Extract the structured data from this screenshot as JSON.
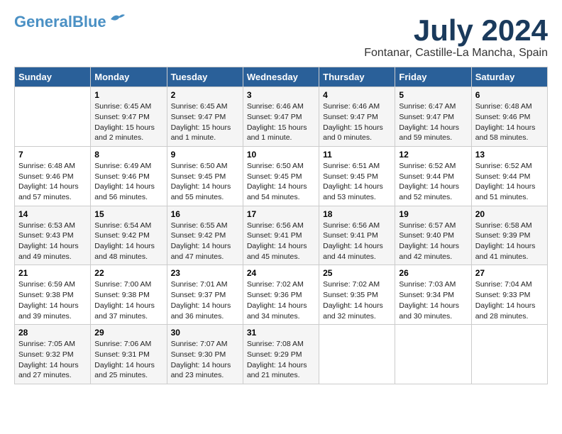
{
  "header": {
    "logo_line1": "General",
    "logo_line2": "Blue",
    "month_title": "July 2024",
    "location": "Fontanar, Castille-La Mancha, Spain"
  },
  "days_of_week": [
    "Sunday",
    "Monday",
    "Tuesday",
    "Wednesday",
    "Thursday",
    "Friday",
    "Saturday"
  ],
  "weeks": [
    [
      {
        "day": "",
        "info": ""
      },
      {
        "day": "1",
        "info": "Sunrise: 6:45 AM\nSunset: 9:47 PM\nDaylight: 15 hours\nand 2 minutes."
      },
      {
        "day": "2",
        "info": "Sunrise: 6:45 AM\nSunset: 9:47 PM\nDaylight: 15 hours\nand 1 minute."
      },
      {
        "day": "3",
        "info": "Sunrise: 6:46 AM\nSunset: 9:47 PM\nDaylight: 15 hours\nand 1 minute."
      },
      {
        "day": "4",
        "info": "Sunrise: 6:46 AM\nSunset: 9:47 PM\nDaylight: 15 hours\nand 0 minutes."
      },
      {
        "day": "5",
        "info": "Sunrise: 6:47 AM\nSunset: 9:47 PM\nDaylight: 14 hours\nand 59 minutes."
      },
      {
        "day": "6",
        "info": "Sunrise: 6:48 AM\nSunset: 9:46 PM\nDaylight: 14 hours\nand 58 minutes."
      }
    ],
    [
      {
        "day": "7",
        "info": "Sunrise: 6:48 AM\nSunset: 9:46 PM\nDaylight: 14 hours\nand 57 minutes."
      },
      {
        "day": "8",
        "info": "Sunrise: 6:49 AM\nSunset: 9:46 PM\nDaylight: 14 hours\nand 56 minutes."
      },
      {
        "day": "9",
        "info": "Sunrise: 6:50 AM\nSunset: 9:45 PM\nDaylight: 14 hours\nand 55 minutes."
      },
      {
        "day": "10",
        "info": "Sunrise: 6:50 AM\nSunset: 9:45 PM\nDaylight: 14 hours\nand 54 minutes."
      },
      {
        "day": "11",
        "info": "Sunrise: 6:51 AM\nSunset: 9:45 PM\nDaylight: 14 hours\nand 53 minutes."
      },
      {
        "day": "12",
        "info": "Sunrise: 6:52 AM\nSunset: 9:44 PM\nDaylight: 14 hours\nand 52 minutes."
      },
      {
        "day": "13",
        "info": "Sunrise: 6:52 AM\nSunset: 9:44 PM\nDaylight: 14 hours\nand 51 minutes."
      }
    ],
    [
      {
        "day": "14",
        "info": "Sunrise: 6:53 AM\nSunset: 9:43 PM\nDaylight: 14 hours\nand 49 minutes."
      },
      {
        "day": "15",
        "info": "Sunrise: 6:54 AM\nSunset: 9:42 PM\nDaylight: 14 hours\nand 48 minutes."
      },
      {
        "day": "16",
        "info": "Sunrise: 6:55 AM\nSunset: 9:42 PM\nDaylight: 14 hours\nand 47 minutes."
      },
      {
        "day": "17",
        "info": "Sunrise: 6:56 AM\nSunset: 9:41 PM\nDaylight: 14 hours\nand 45 minutes."
      },
      {
        "day": "18",
        "info": "Sunrise: 6:56 AM\nSunset: 9:41 PM\nDaylight: 14 hours\nand 44 minutes."
      },
      {
        "day": "19",
        "info": "Sunrise: 6:57 AM\nSunset: 9:40 PM\nDaylight: 14 hours\nand 42 minutes."
      },
      {
        "day": "20",
        "info": "Sunrise: 6:58 AM\nSunset: 9:39 PM\nDaylight: 14 hours\nand 41 minutes."
      }
    ],
    [
      {
        "day": "21",
        "info": "Sunrise: 6:59 AM\nSunset: 9:38 PM\nDaylight: 14 hours\nand 39 minutes."
      },
      {
        "day": "22",
        "info": "Sunrise: 7:00 AM\nSunset: 9:38 PM\nDaylight: 14 hours\nand 37 minutes."
      },
      {
        "day": "23",
        "info": "Sunrise: 7:01 AM\nSunset: 9:37 PM\nDaylight: 14 hours\nand 36 minutes."
      },
      {
        "day": "24",
        "info": "Sunrise: 7:02 AM\nSunset: 9:36 PM\nDaylight: 14 hours\nand 34 minutes."
      },
      {
        "day": "25",
        "info": "Sunrise: 7:02 AM\nSunset: 9:35 PM\nDaylight: 14 hours\nand 32 minutes."
      },
      {
        "day": "26",
        "info": "Sunrise: 7:03 AM\nSunset: 9:34 PM\nDaylight: 14 hours\nand 30 minutes."
      },
      {
        "day": "27",
        "info": "Sunrise: 7:04 AM\nSunset: 9:33 PM\nDaylight: 14 hours\nand 28 minutes."
      }
    ],
    [
      {
        "day": "28",
        "info": "Sunrise: 7:05 AM\nSunset: 9:32 PM\nDaylight: 14 hours\nand 27 minutes."
      },
      {
        "day": "29",
        "info": "Sunrise: 7:06 AM\nSunset: 9:31 PM\nDaylight: 14 hours\nand 25 minutes."
      },
      {
        "day": "30",
        "info": "Sunrise: 7:07 AM\nSunset: 9:30 PM\nDaylight: 14 hours\nand 23 minutes."
      },
      {
        "day": "31",
        "info": "Sunrise: 7:08 AM\nSunset: 9:29 PM\nDaylight: 14 hours\nand 21 minutes."
      },
      {
        "day": "",
        "info": ""
      },
      {
        "day": "",
        "info": ""
      },
      {
        "day": "",
        "info": ""
      }
    ]
  ]
}
